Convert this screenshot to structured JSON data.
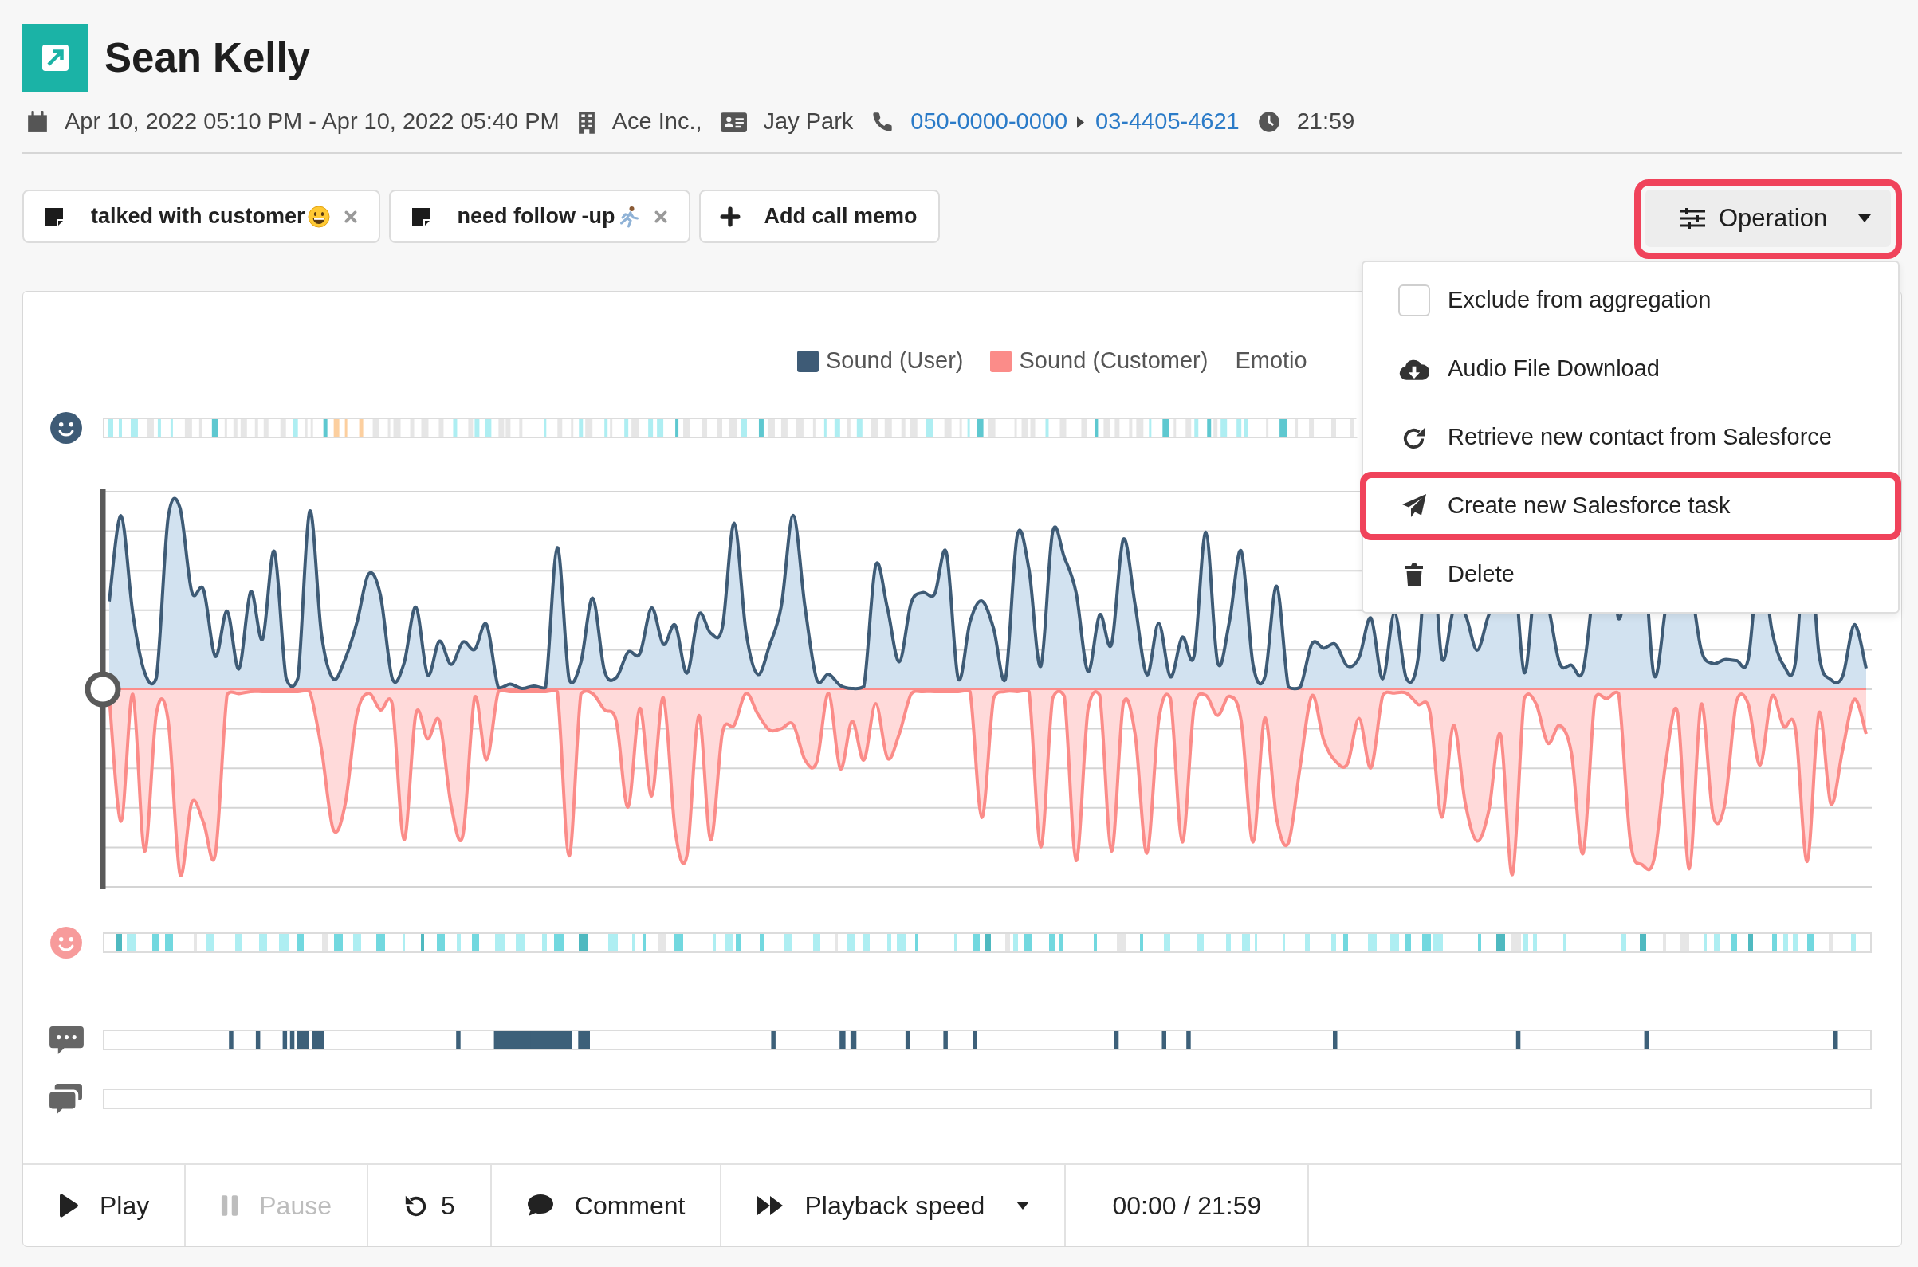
{
  "header": {
    "title": "Sean Kelly",
    "period": "Apr 10, 2022 05:10 PM - Apr 10, 2022 05:40 PM",
    "company": "Ace Inc.,",
    "contact": "Jay Park",
    "caller_number": "050-0000-0000",
    "callee_number": "03-4405-4621",
    "duration": "21:59"
  },
  "memos": [
    {
      "text": "talked with customer"
    },
    {
      "text": "need follow -up"
    }
  ],
  "add_memo_label": "Add call memo",
  "operation_menu": {
    "label": "Operation",
    "expanded": true,
    "highlighted": true,
    "items": [
      {
        "kind": "checkbox",
        "label": "Exclude from aggregation",
        "checked": false,
        "highlighted": false
      },
      {
        "kind": "download",
        "label": "Audio File Download",
        "highlighted": false
      },
      {
        "kind": "refresh",
        "label": "Retrieve new contact from Salesforce",
        "highlighted": false
      },
      {
        "kind": "send",
        "label": "Create new Salesforce task",
        "highlighted": true
      },
      {
        "kind": "delete",
        "label": "Delete",
        "highlighted": false
      }
    ]
  },
  "legend": [
    {
      "label": "Sound (User)",
      "color": "#3e5b76"
    },
    {
      "label": "Sound (Customer)",
      "color": "#fb8c89"
    },
    {
      "label": "Emotio"
    }
  ],
  "playhead": {
    "level": 0
  },
  "toolbar": [
    {
      "kind": "play",
      "label": "Play",
      "disabled": false
    },
    {
      "kind": "pause",
      "label": "Pause",
      "disabled": true
    },
    {
      "kind": "rewind",
      "label": "5",
      "disabled": false
    },
    {
      "kind": "comment",
      "label": "Comment",
      "disabled": false
    },
    {
      "kind": "speed",
      "label": "Playback speed",
      "disabled": false
    }
  ],
  "time_display": "00:00 / 21:59"
}
